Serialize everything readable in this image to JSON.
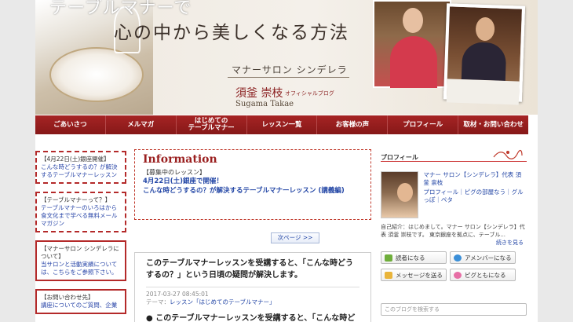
{
  "header": {
    "tagline_top": "テーブルマナーで",
    "tagline": "心の中から美しくなる方法",
    "salon": "マナーサロン シンデレラ",
    "author": "須釜 崇枝",
    "author_sub": "オフィシャルブログ",
    "author_roman": "Sugama Takae"
  },
  "nav": [
    "ごあいさつ",
    "メルマガ",
    "はじめての\nテーブルマナー",
    "レッスン一覧",
    "お客様の声",
    "プロフィール",
    "取材・お問い合わせ"
  ],
  "left_boxes": [
    {
      "title": "【4月22日(土)銀座開催】",
      "body": "こんな時どうするの？が解決するテーブルマナーレッスン"
    },
    {
      "title": "【テーブルマナーって？】",
      "body": "テーブルマナーのいろはから食文化まで学べる無料メールマガジン"
    },
    {
      "title": "【マナーサロン シンデレラについて】",
      "body": "当サロンと活動実績については、こちらをご参照下さい。"
    },
    {
      "title": "【お問い合わせ先】",
      "body": "講座についてのご質問、企業"
    }
  ],
  "info": {
    "title": "Information",
    "text": "【募集中のレッスン】",
    "link1": "4月22日(土)銀座で開催！",
    "link2": "こんな時どうするの？が解決するテーブルマナーレッスン (講義編)"
  },
  "pager": {
    "next": "次ページ >>"
  },
  "article": {
    "title": "このテーブルマナーレッスンを受講すると、「こんな時どうするの？」という日頃の疑問が解決します。",
    "date": "2017-03-27 08:45:01",
    "theme_label": "テーマ：",
    "theme": "レッスン「はじめてのテーブルマナー」",
    "body": "● このテーブルマナーレッスンを受講すると、「こんな時ど"
  },
  "profile": {
    "heading": "プロフィール",
    "name": "マナー サロン【シンデレラ】代表 須釜 崇枝",
    "links": "プロフィール｜ピグの部屋なう｜グルっぽ｜ペタ",
    "desc": "自己紹介：はじめまして。マナー サロン【シンデレラ】代表 須釜 崇枝です。 東京銀座を拠点に、テーブル...",
    "more": "続きを見る",
    "buttons": [
      {
        "label": "読者になる",
        "icon": "reader-icon",
        "color": "#6fae3b"
      },
      {
        "label": "アメンバーになる",
        "icon": "amember-icon",
        "color": "#3b8fd8"
      },
      {
        "label": "メッセージを送る",
        "icon": "message-icon",
        "color": "#e9b43a"
      },
      {
        "label": "ピグともになる",
        "icon": "pigg-icon",
        "color": "#e76fa6"
      }
    ],
    "search_placeholder": "このブログを検索する"
  }
}
